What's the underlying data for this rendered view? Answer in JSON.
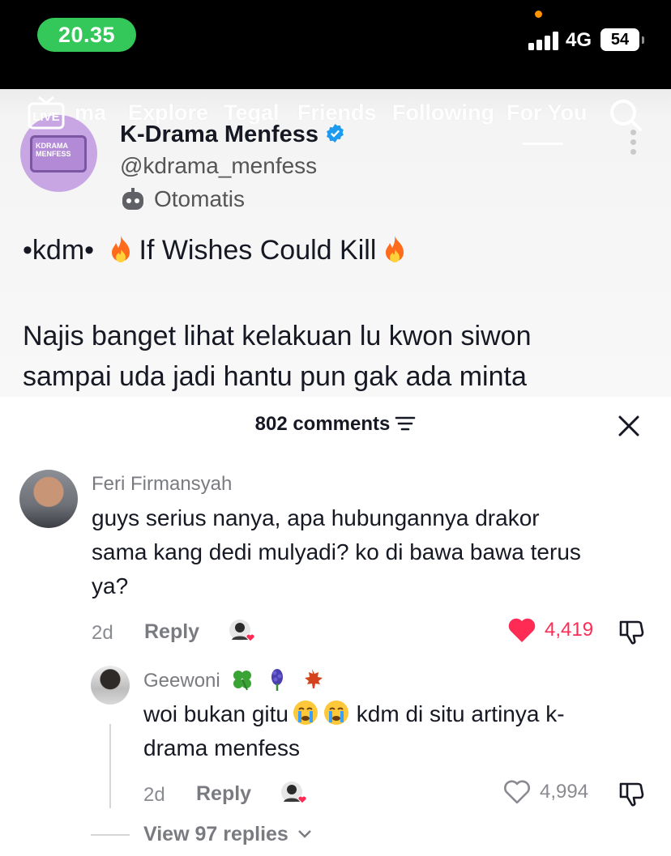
{
  "status_bar": {
    "time": "20.35",
    "network": "4G",
    "battery": "54"
  },
  "top_nav": {
    "live_label": "LIVE",
    "items": [
      "ma",
      "Explore",
      "Tegal",
      "Friends",
      "Following",
      "For You"
    ]
  },
  "post": {
    "account_name": "K-Drama Menfess",
    "handle": "@kdrama_menfess",
    "auto_label": "Otomatis",
    "title_prefix": "•kdm•",
    "title": "If Wishes Could Kill",
    "body_line1": "Najis banget lihat kelakuan lu kwon siwon",
    "body_line2": "sampai uda jadi hantu pun gak ada minta",
    "logo_text_1": "KDRAMA",
    "logo_text_2": "MENFESS"
  },
  "comments_sheet": {
    "title": "802 comments",
    "comments": [
      {
        "username": "Feri Firmansyah",
        "text_line1": "guys serius nanya, apa hubungannya drakor",
        "text_line2": "sama kang dedi mulyadi? ko di bawa bawa terus",
        "text_line3": "ya?",
        "age": "2d",
        "reply_label": "Reply",
        "likes": "4,419",
        "liked": true
      },
      {
        "username": "Geewoni",
        "text_line1a": "woi bukan gitu",
        "text_line1b": "kdm di situ artinya k-",
        "text_line2": "drama menfess",
        "age": "2d",
        "reply_label": "Reply",
        "likes": "4,994",
        "liked": false
      }
    ],
    "view_replies": "View 97 replies"
  },
  "colors": {
    "accent_red": "#fe2c55",
    "status_green": "#34c759",
    "verified_blue": "#20d5ec"
  }
}
